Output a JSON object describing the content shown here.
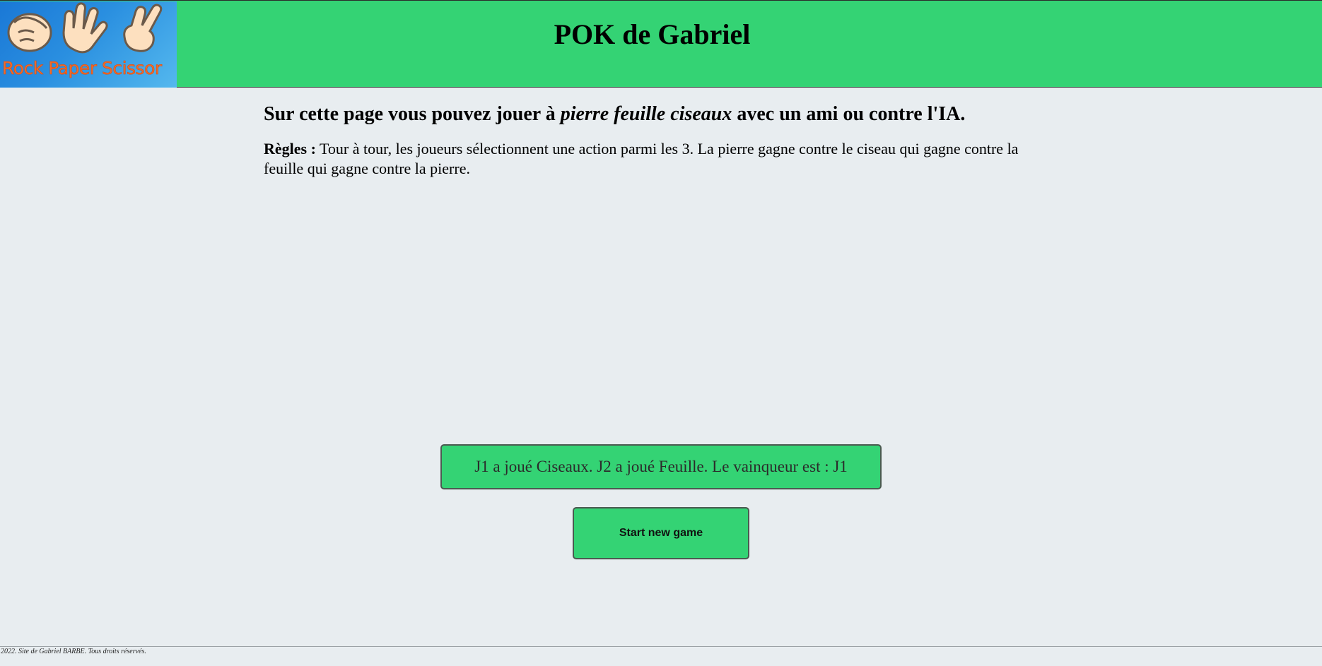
{
  "header": {
    "logo_text": "Rock Paper Scissor",
    "title": "POK de Gabriel"
  },
  "intro": {
    "heading_before": "Sur cette page vous pouvez jouer à ",
    "heading_italic": "pierre feuille ciseaux",
    "heading_after": " avec un ami ou contre l'IA.",
    "rules_label": "Règles :",
    "rules_text": " Tour à tour, les joueurs sélectionnent une action parmi les 3. La pierre gagne contre le ciseau qui gagne contre la feuille qui gagne contre la pierre."
  },
  "game": {
    "result_text": "J1 a joué Ciseaux. J2 a joué Feuille. Le vainqueur est : J1",
    "new_game_label": "Start new game"
  },
  "footer": {
    "text": "2022. Site de Gabriel BARBE. Tous droits réservés."
  },
  "colors": {
    "header_green": "#34d374",
    "page_background": "#e8edf0",
    "logo_text_orange": "#f26a2a"
  }
}
